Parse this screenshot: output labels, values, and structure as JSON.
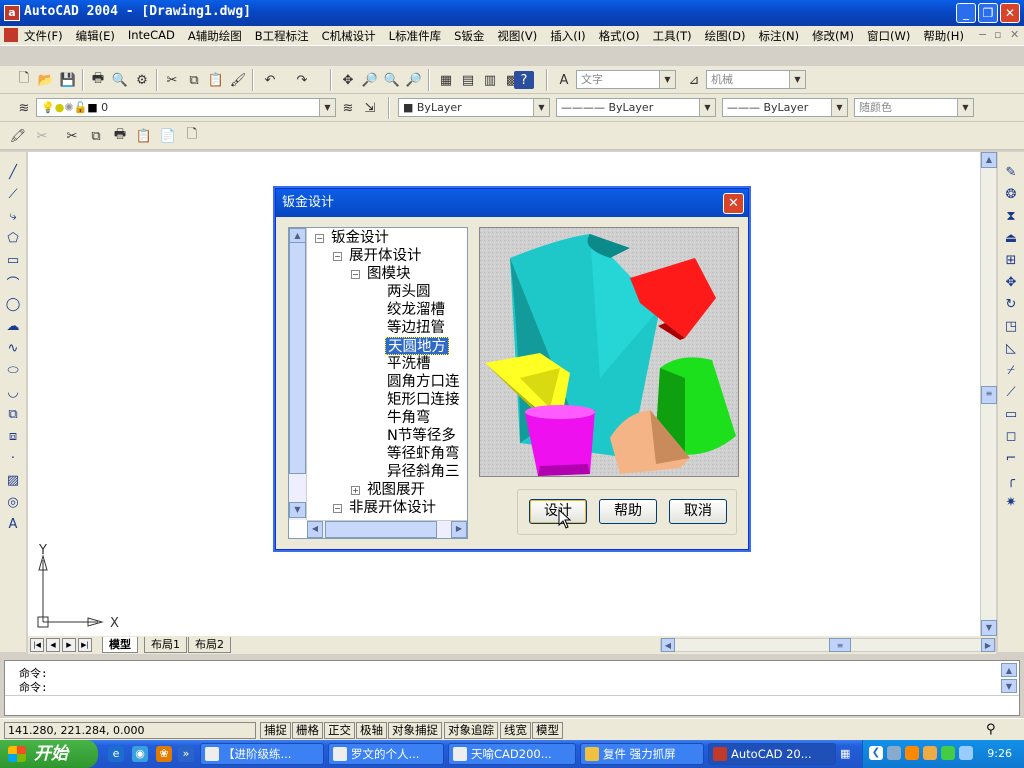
{
  "window": {
    "title": "AutoCAD 2004 - [Drawing1.dwg]",
    "controls": {
      "minimize": "_",
      "restore": "❐",
      "close": "✕"
    }
  },
  "menu": {
    "items": [
      "文件(F)",
      "编辑(E)",
      "InteCAD",
      "A辅助绘图",
      "B工程标注",
      "C机械设计",
      "L标准件库",
      "S钣金",
      "视图(V)",
      "插入(I)",
      "格式(O)",
      "工具(T)",
      "绘图(D)",
      "标注(N)",
      "修改(M)",
      "窗口(W)",
      "帮助(H)"
    ],
    "mdi_controls": {
      "minimize": "−",
      "restore": "▫",
      "close": "✕"
    }
  },
  "toolbar": {
    "text_style": "文字",
    "dim_style": "机械"
  },
  "layers": {
    "current_layer": "0",
    "color": "ByLayer",
    "linetype": "ByLayer",
    "lineweight": "ByLayer",
    "plot_style": "随颜色"
  },
  "ucs": {
    "y_label": "Y",
    "x_label": "X"
  },
  "layout_tabs": [
    "模型",
    "布局1",
    "布局2"
  ],
  "command": {
    "lines": [
      "命令:",
      "命令:"
    ]
  },
  "status": {
    "coordinates": "141.280, 221.284, 0.000",
    "toggles": [
      "捕捉",
      "栅格",
      "正交",
      "极轴",
      "对象捕捉",
      "对象追踪",
      "线宽",
      "模型"
    ]
  },
  "taskbar": {
    "start_label": "开始",
    "tasks": [
      "【进阶级练...",
      "罗文的个人...",
      "天喻CAD200...",
      "复件 强力抓屏",
      "AutoCAD 20..."
    ],
    "clock": "9:26"
  },
  "dialog": {
    "title": "钣金设计",
    "close": "✕",
    "tree": {
      "root": "钣金设计",
      "level1_a": "展开体设计",
      "level2_a": "图模块",
      "items": [
        "两头圆",
        "绞龙溜槽",
        "等边扭管",
        "天圆地方",
        "平洗槽",
        "圆角方口连",
        "矩形口连接",
        "牛角弯",
        "N节等径多",
        "等径虾角弯",
        "异径斜角三"
      ],
      "selected": "天圆地方",
      "level2_b": "视图展开",
      "level1_b": "非展开体设计"
    },
    "buttons": {
      "design": "设计",
      "help": "帮助",
      "cancel": "取消"
    }
  },
  "colors": {
    "titlebar": "#0846c0",
    "taskbar": "#245edb",
    "start": "#3c9c3c",
    "selection": "#316ac5"
  }
}
